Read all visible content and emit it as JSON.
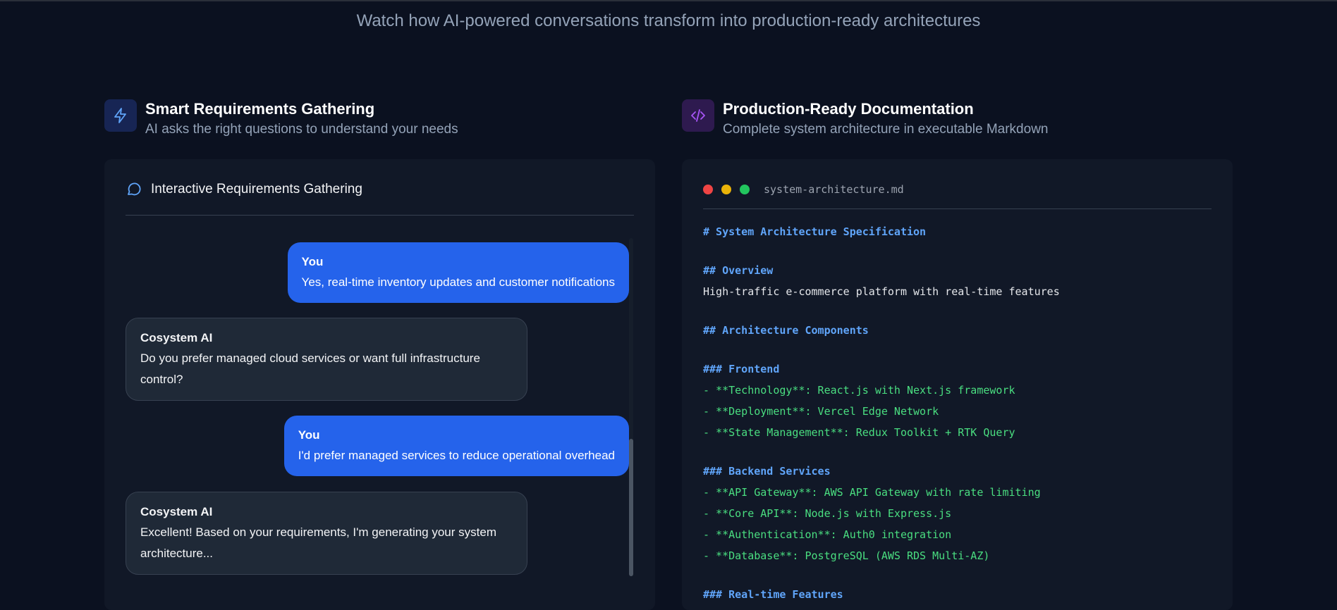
{
  "subtitle": "Watch how AI-powered conversations transform into production-ready architectures",
  "left_section": {
    "icon": "lightning-icon",
    "title": "Smart Requirements Gathering",
    "subtitle": "AI asks the right questions to understand your needs",
    "panel_title": "Interactive Requirements Gathering",
    "messages": [
      {
        "sender": "You",
        "text": "Yes, real-time inventory updates and customer notifications"
      },
      {
        "sender": "Cosystem AI",
        "text": "Do you prefer managed cloud services or want full infrastructure control?"
      },
      {
        "sender": "You",
        "text": "I'd prefer managed services to reduce operational overhead"
      },
      {
        "sender": "Cosystem AI",
        "text": "Excellent! Based on your requirements, I'm generating your system architecture..."
      }
    ]
  },
  "right_section": {
    "icon": "code-icon",
    "title": "Production-Ready Documentation",
    "subtitle": "Complete system architecture in executable Markdown",
    "filename": "system-architecture.md",
    "lines": [
      "# System Architecture Specification",
      "",
      "## Overview",
      "High-traffic e-commerce platform with real-time features",
      "",
      "## Architecture Components",
      "",
      "### Frontend",
      "- **Technology**: React.js with Next.js framework",
      "- **Deployment**: Vercel Edge Network",
      "- **State Management**: Redux Toolkit + RTK Query",
      "",
      "### Backend Services",
      "- **API Gateway**: AWS API Gateway with rate limiting",
      "- **Core API**: Node.js with Express.js",
      "- **Authentication**: Auth0 integration",
      "- **Database**: PostgreSQL (AWS RDS Multi-AZ)",
      "",
      "### Real-time Features"
    ]
  },
  "colors": {
    "user_bubble": "#2563eb",
    "heading": "#60a5fa",
    "list": "#4ade80",
    "dot_red": "#ef4444",
    "dot_yellow": "#eab308",
    "dot_green": "#22c55e"
  }
}
